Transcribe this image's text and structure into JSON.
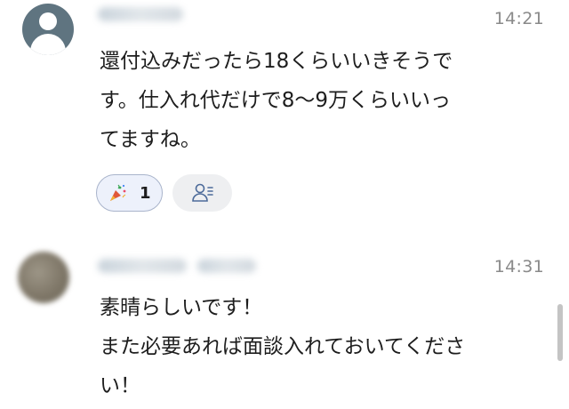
{
  "messages": [
    {
      "time": "14:21",
      "text": "還付込みだったら18くらいいきそうで\nす。仕入れ代だけで8～9万くらいいっ\nてますね。",
      "reactions": [
        {
          "icon": "party-popper-icon",
          "count": "1"
        }
      ]
    },
    {
      "time": "14:31",
      "text": "素晴らしいです！\nまた必要あれば面談入れておいてくださ\nい！"
    }
  ],
  "icons": {
    "avatar_default": "default-user-avatar-icon",
    "add_reaction": "reaction-users-icon"
  },
  "colors": {
    "avatar_bg": "#5f7480",
    "reaction_bg": "#edf1fb",
    "reaction_border": "#a9b4cb",
    "time": "#8a8a8a"
  }
}
